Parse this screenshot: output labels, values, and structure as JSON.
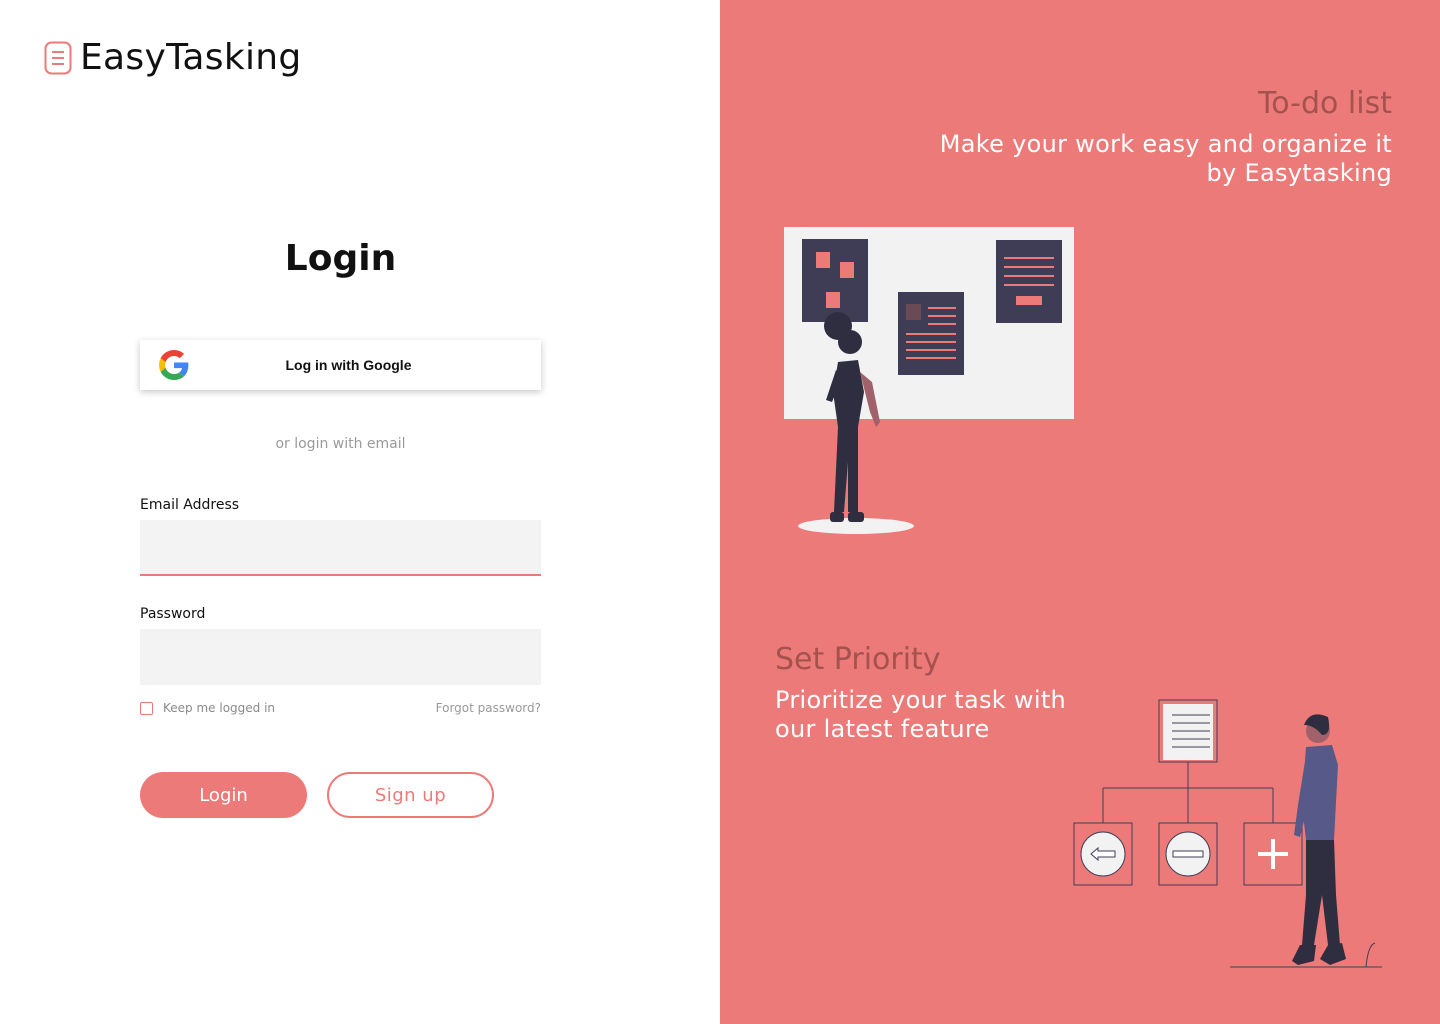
{
  "brand": {
    "name": "EasyTasking",
    "accent": "#ec7a78"
  },
  "login": {
    "title": "Login",
    "google_label": "Log in with Google",
    "or_email": "or login with email",
    "email_label": "Email Address",
    "email_value": "",
    "password_label": "Password",
    "password_value": "",
    "keep_logged_in": "Keep me logged in",
    "keep_checked": false,
    "forgot_password": "Forgot password?",
    "login_button": "Login",
    "signup_button": "Sign up"
  },
  "features": {
    "todo": {
      "title": "To-do list",
      "description": "Make your work easy and organize it by Easytasking"
    },
    "priority": {
      "title": "Set Priority",
      "description": "Prioritize your task with our latest feature"
    }
  },
  "icons": [
    "list-logo-icon",
    "google-icon",
    "arrow-left-icon",
    "minus-icon",
    "plus-icon"
  ]
}
